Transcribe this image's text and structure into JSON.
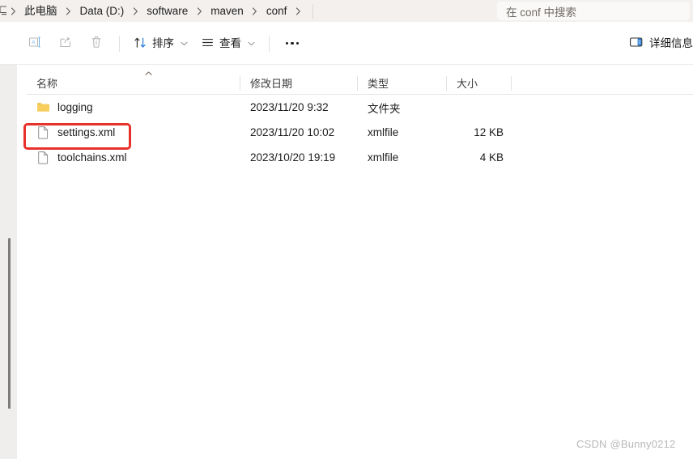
{
  "window": {
    "kind": "windows-file-explorer"
  },
  "addressbar": {
    "crumb_icon": "monitor-icon",
    "breadcrumbs": [
      {
        "label": "此电脑",
        "icon": "this-pc"
      },
      {
        "label": "Data (D:)",
        "icon": "drive"
      },
      {
        "label": "software",
        "icon": "folder"
      },
      {
        "label": "maven",
        "icon": "folder"
      },
      {
        "label": "conf",
        "icon": "folder"
      }
    ],
    "separator": "›",
    "search": {
      "placeholder": "在 conf 中搜索",
      "value": ""
    }
  },
  "toolbar": {
    "rename_label": "",
    "share_label": "",
    "delete_label": "",
    "sort_label": "排序",
    "view_label": "查看",
    "more_label": "",
    "details_label": "详细信息",
    "icons": {
      "rename": "rename-icon",
      "share": "share-icon",
      "delete": "trash-icon",
      "sort": "sort-arrows-icon",
      "view": "list-lines-icon",
      "more": "ellipsis-icon",
      "details": "details-pane-icon"
    }
  },
  "columns": {
    "name": "名称",
    "date": "修改日期",
    "type": "类型",
    "size": "大小",
    "sort_direction": "ascending"
  },
  "files": [
    {
      "name": "logging",
      "icon": "folder-icon",
      "date": "2023/11/20 9:32",
      "type": "文件夹",
      "size": ""
    },
    {
      "name": "settings.xml",
      "icon": "file-icon",
      "date": "2023/11/20 10:02",
      "type": "xmlfile",
      "size": "12 KB"
    },
    {
      "name": "toolchains.xml",
      "icon": "file-icon",
      "date": "2023/10/20 19:19",
      "type": "xmlfile",
      "size": "4 KB"
    }
  ],
  "annotation": {
    "target": "settings.xml",
    "color": "#e8312a",
    "shape": "rounded-rectangle"
  },
  "watermark": {
    "text": "CSDN @Bunny0212"
  },
  "colors": {
    "addressbar_bg": "#f3f0ee",
    "navpane_bg": "#f0eeec",
    "folder_yellow": "#f7ce5b",
    "accent_blue": "#1e78d7",
    "annotation_red": "#e8312a"
  }
}
